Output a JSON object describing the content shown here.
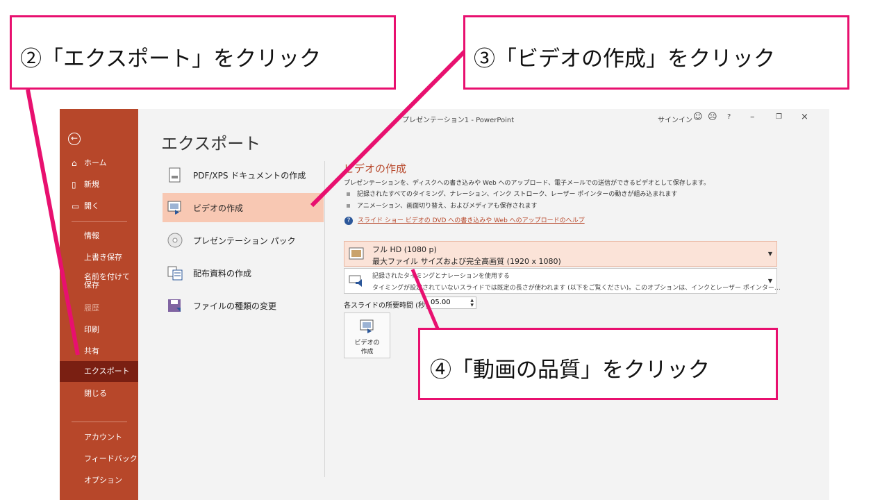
{
  "window": {
    "title": "プレゼンテーション1 - PowerPoint",
    "signin": "サインイン",
    "help": "?"
  },
  "nav": {
    "back": "⇐",
    "home": "ホーム",
    "new": "新規",
    "open": "開く",
    "info": "情報",
    "save": "上書き保存",
    "save_as": "名前を付けて保存",
    "history": "履歴",
    "print": "印刷",
    "share": "共有",
    "export": "エクスポート",
    "close": "閉じる",
    "account": "アカウント",
    "feedback": "フィードバック",
    "options": "オプション"
  },
  "page": {
    "title": "エクスポート"
  },
  "export_options": [
    {
      "label": "PDF/XPS ドキュメントの作成"
    },
    {
      "label": "ビデオの作成"
    },
    {
      "label": "プレゼンテーション パック"
    },
    {
      "label": "配布資料の作成"
    },
    {
      "label": "ファイルの種類の変更"
    }
  ],
  "video": {
    "title": "ビデオの作成",
    "description": "プレゼンテーションを、ディスクへの書き込みや Web へのアップロード、電子メールでの送信ができるビデオとして保存します。",
    "bullet1": "記録されたすべてのタイミング、ナレーション、インク ストローク、レーザー ポインターの動きが組み込まれます",
    "bullet2": "アニメーション、画面切り替え、およびメディアも保存されます",
    "help_link": "スライド ショー ビデオの DVD への書き込みや Web へのアップロードのヘルプ",
    "quality_title": "フル HD (1080 p)",
    "quality_desc": "最大ファイル サイズおよび完全高画質 (1920 x 1080)",
    "timing_title": "記録されたタイミングとナレーションを使用する",
    "timing_desc": "タイミングが設定されていないスライドでは既定の長さが使われます (以下をご覧ください)。このオプションは、インクとレーザー ポインター…",
    "seconds_label": "各スライドの所要時間 (秒):",
    "seconds_value": "05.00",
    "create_label_1": "ビデオの",
    "create_label_2": "作成"
  },
  "callouts": {
    "step2": "②「エクスポート」をクリック",
    "step3": "③「ビデオの作成」をクリック",
    "step4": "④「動画の品質」をクリック"
  },
  "colors": {
    "backstage": "#b7472a",
    "accent": "#e8106f",
    "selected": "#f8c8b3"
  }
}
